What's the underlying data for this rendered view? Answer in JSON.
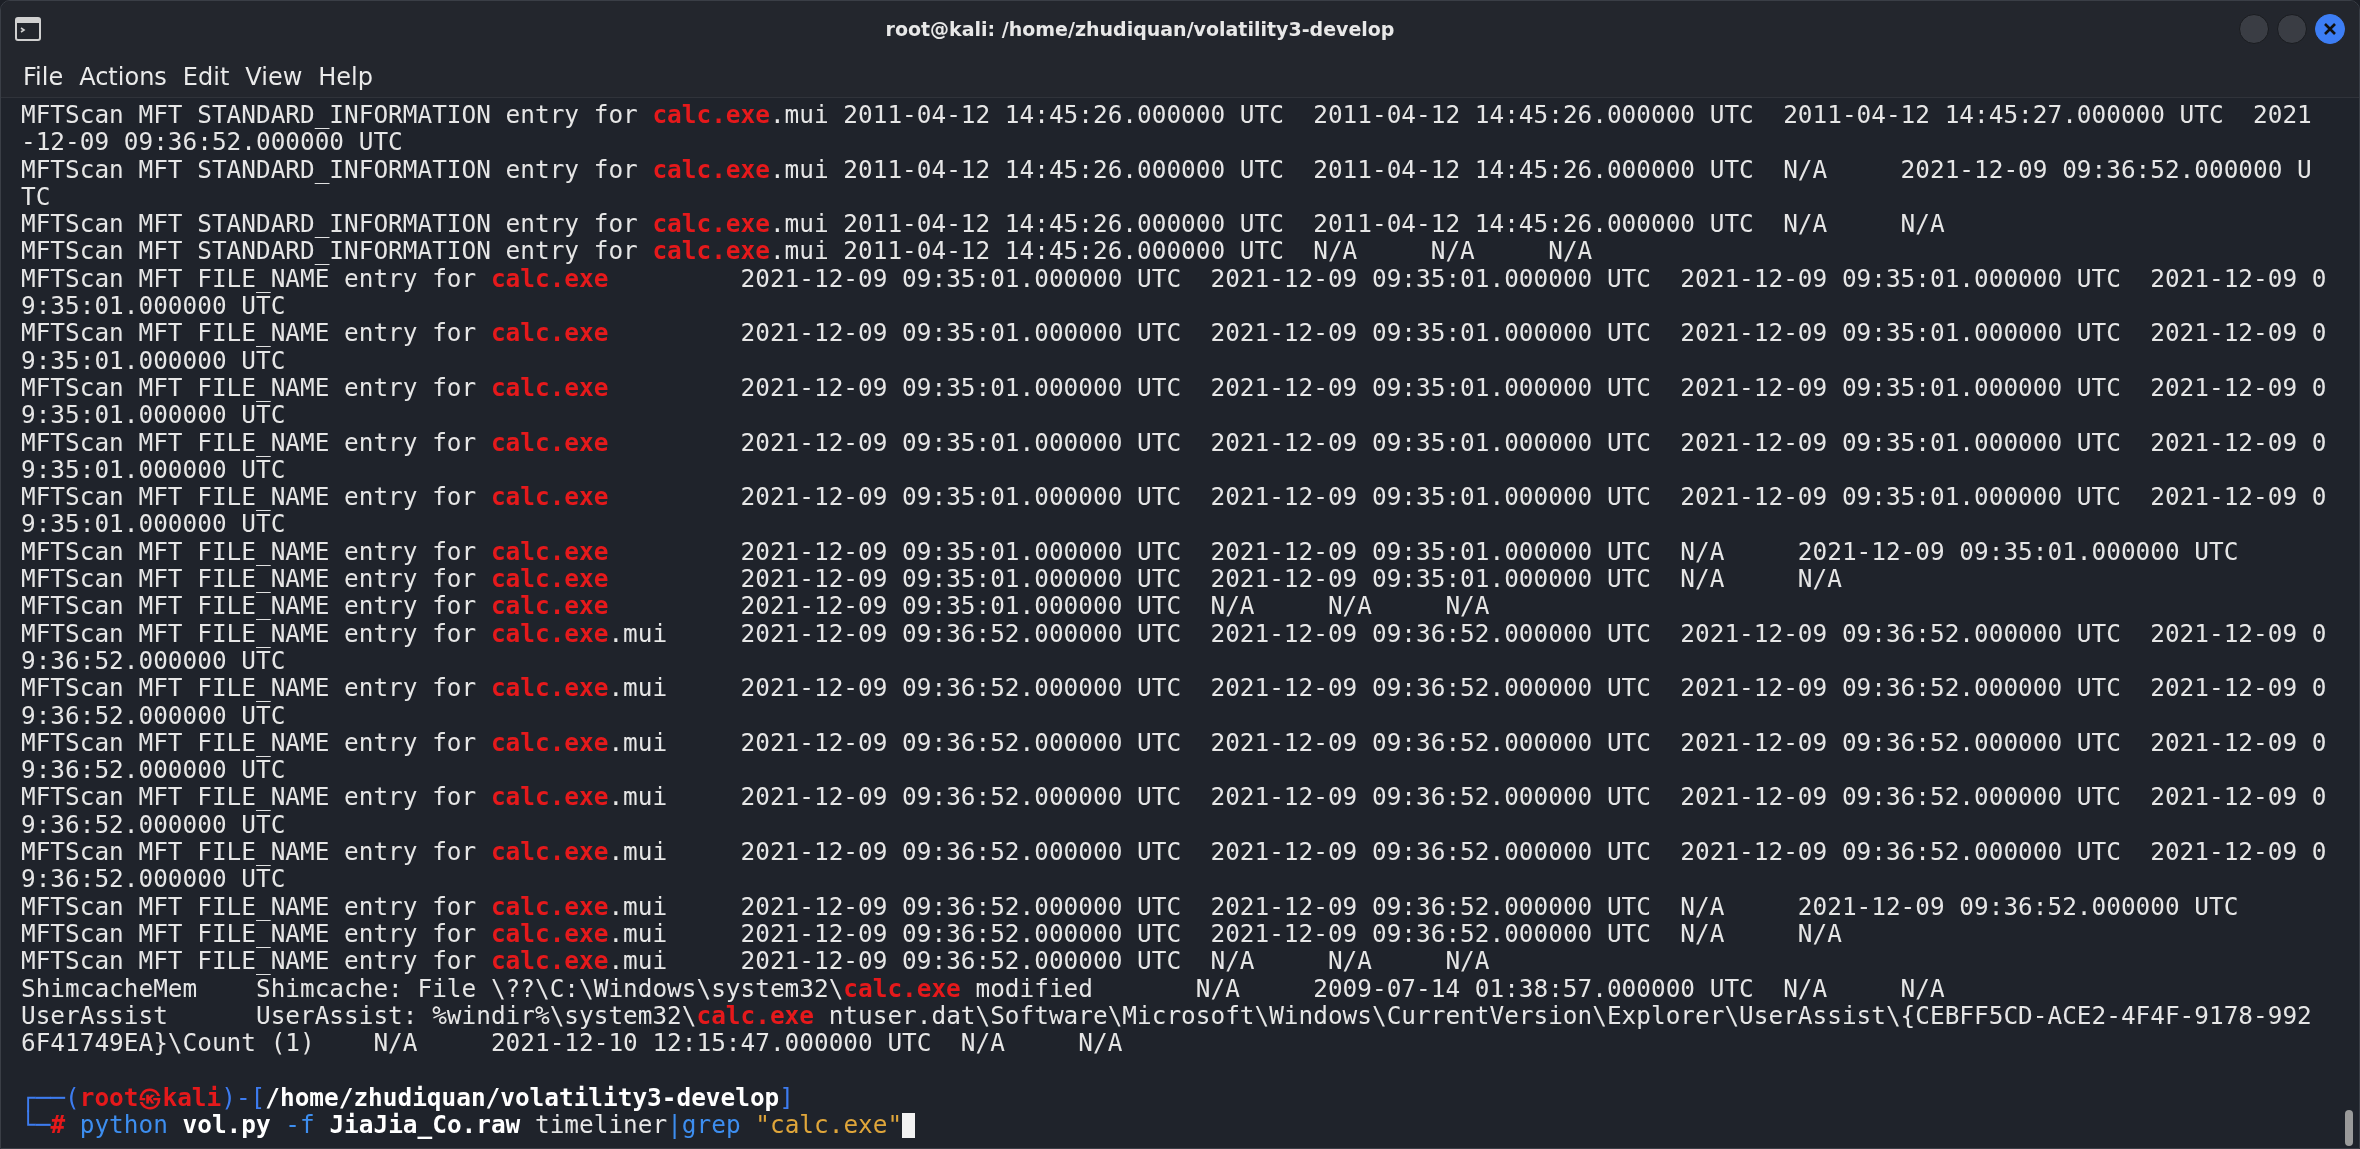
{
  "window": {
    "title": "root@kali: /home/zhudiquan/volatility3-develop"
  },
  "menu": [
    "File",
    "Actions",
    "Edit",
    "View",
    "Help"
  ],
  "output": [
    {
      "before": "MFTScan MFT STANDARD_INFORMATION entry for ",
      "match": "calc.exe",
      "after": ".mui 2011-04-12 14:45:26.000000 UTC  2011-04-12 14:45:26.000000 UTC  2011-04-12 14:45:27.000000 UTC  2021"
    },
    {
      "before": "-12-09 09:36:52.000000 UTC"
    },
    {
      "before": "MFTScan MFT STANDARD_INFORMATION entry for ",
      "match": "calc.exe",
      "after": ".mui 2011-04-12 14:45:26.000000 UTC  2011-04-12 14:45:26.000000 UTC  N/A     2021-12-09 09:36:52.000000 U"
    },
    {
      "before": "TC"
    },
    {
      "before": "MFTScan MFT STANDARD_INFORMATION entry for ",
      "match": "calc.exe",
      "after": ".mui 2011-04-12 14:45:26.000000 UTC  2011-04-12 14:45:26.000000 UTC  N/A     N/A"
    },
    {
      "before": "MFTScan MFT STANDARD_INFORMATION entry for ",
      "match": "calc.exe",
      "after": ".mui 2011-04-12 14:45:26.000000 UTC  N/A     N/A     N/A"
    },
    {
      "before": "MFTScan MFT FILE_NAME entry for ",
      "match": "calc.exe",
      "after": "         2021-12-09 09:35:01.000000 UTC  2021-12-09 09:35:01.000000 UTC  2021-12-09 09:35:01.000000 UTC  2021-12-09 0"
    },
    {
      "before": "9:35:01.000000 UTC"
    },
    {
      "before": "MFTScan MFT FILE_NAME entry for ",
      "match": "calc.exe",
      "after": "         2021-12-09 09:35:01.000000 UTC  2021-12-09 09:35:01.000000 UTC  2021-12-09 09:35:01.000000 UTC  2021-12-09 0"
    },
    {
      "before": "9:35:01.000000 UTC"
    },
    {
      "before": "MFTScan MFT FILE_NAME entry for ",
      "match": "calc.exe",
      "after": "         2021-12-09 09:35:01.000000 UTC  2021-12-09 09:35:01.000000 UTC  2021-12-09 09:35:01.000000 UTC  2021-12-09 0"
    },
    {
      "before": "9:35:01.000000 UTC"
    },
    {
      "before": "MFTScan MFT FILE_NAME entry for ",
      "match": "calc.exe",
      "after": "         2021-12-09 09:35:01.000000 UTC  2021-12-09 09:35:01.000000 UTC  2021-12-09 09:35:01.000000 UTC  2021-12-09 0"
    },
    {
      "before": "9:35:01.000000 UTC"
    },
    {
      "before": "MFTScan MFT FILE_NAME entry for ",
      "match": "calc.exe",
      "after": "         2021-12-09 09:35:01.000000 UTC  2021-12-09 09:35:01.000000 UTC  2021-12-09 09:35:01.000000 UTC  2021-12-09 0"
    },
    {
      "before": "9:35:01.000000 UTC"
    },
    {
      "before": "MFTScan MFT FILE_NAME entry for ",
      "match": "calc.exe",
      "after": "         2021-12-09 09:35:01.000000 UTC  2021-12-09 09:35:01.000000 UTC  N/A     2021-12-09 09:35:01.000000 UTC"
    },
    {
      "before": "MFTScan MFT FILE_NAME entry for ",
      "match": "calc.exe",
      "after": "         2021-12-09 09:35:01.000000 UTC  2021-12-09 09:35:01.000000 UTC  N/A     N/A"
    },
    {
      "before": "MFTScan MFT FILE_NAME entry for ",
      "match": "calc.exe",
      "after": "         2021-12-09 09:35:01.000000 UTC  N/A     N/A     N/A"
    },
    {
      "before": "MFTScan MFT FILE_NAME entry for ",
      "match": "calc.exe",
      "after": ".mui     2021-12-09 09:36:52.000000 UTC  2021-12-09 09:36:52.000000 UTC  2021-12-09 09:36:52.000000 UTC  2021-12-09 0"
    },
    {
      "before": "9:36:52.000000 UTC"
    },
    {
      "before": "MFTScan MFT FILE_NAME entry for ",
      "match": "calc.exe",
      "after": ".mui     2021-12-09 09:36:52.000000 UTC  2021-12-09 09:36:52.000000 UTC  2021-12-09 09:36:52.000000 UTC  2021-12-09 0"
    },
    {
      "before": "9:36:52.000000 UTC"
    },
    {
      "before": "MFTScan MFT FILE_NAME entry for ",
      "match": "calc.exe",
      "after": ".mui     2021-12-09 09:36:52.000000 UTC  2021-12-09 09:36:52.000000 UTC  2021-12-09 09:36:52.000000 UTC  2021-12-09 0"
    },
    {
      "before": "9:36:52.000000 UTC"
    },
    {
      "before": "MFTScan MFT FILE_NAME entry for ",
      "match": "calc.exe",
      "after": ".mui     2021-12-09 09:36:52.000000 UTC  2021-12-09 09:36:52.000000 UTC  2021-12-09 09:36:52.000000 UTC  2021-12-09 0"
    },
    {
      "before": "9:36:52.000000 UTC"
    },
    {
      "before": "MFTScan MFT FILE_NAME entry for ",
      "match": "calc.exe",
      "after": ".mui     2021-12-09 09:36:52.000000 UTC  2021-12-09 09:36:52.000000 UTC  2021-12-09 09:36:52.000000 UTC  2021-12-09 0"
    },
    {
      "before": "9:36:52.000000 UTC"
    },
    {
      "before": "MFTScan MFT FILE_NAME entry for ",
      "match": "calc.exe",
      "after": ".mui     2021-12-09 09:36:52.000000 UTC  2021-12-09 09:36:52.000000 UTC  N/A     2021-12-09 09:36:52.000000 UTC"
    },
    {
      "before": "MFTScan MFT FILE_NAME entry for ",
      "match": "calc.exe",
      "after": ".mui     2021-12-09 09:36:52.000000 UTC  2021-12-09 09:36:52.000000 UTC  N/A     N/A"
    },
    {
      "before": "MFTScan MFT FILE_NAME entry for ",
      "match": "calc.exe",
      "after": ".mui     2021-12-09 09:36:52.000000 UTC  N/A     N/A     N/A"
    },
    {
      "before": "ShimcacheMem    Shimcache: File \\??\\C:\\Windows\\system32\\",
      "match": "calc.exe",
      "after": " modified       N/A     2009-07-14 01:38:57.000000 UTC  N/A     N/A"
    },
    {
      "before": "UserAssist      UserAssist: %windir%\\system32\\",
      "match": "calc.exe",
      "after": " ntuser.dat\\Software\\Microsoft\\Windows\\CurrentVersion\\Explorer\\UserAssist\\{CEBFF5CD-ACE2-4F4F-9178-992"
    },
    {
      "before": "6F41749EA}\\Count (1)    N/A     2021-12-10 12:15:47.000000 UTC  N/A     N/A"
    }
  ],
  "prompt": {
    "lines": [
      [
        {
          "kind": "frame",
          "text": "┌──("
        },
        {
          "kind": "user",
          "text": "root㉿kali"
        },
        {
          "kind": "frame",
          "text": ")-["
        },
        {
          "kind": "path",
          "text": "/home/zhudiquan/volatility3-develop"
        },
        {
          "kind": "frame",
          "text": "]"
        }
      ],
      [
        {
          "kind": "frame",
          "text": "└─"
        },
        {
          "kind": "user",
          "text": "# "
        },
        {
          "kind": "cmd",
          "text": "python"
        },
        {
          "kind": "path",
          "text": " vol.py"
        },
        {
          "kind": "cmd",
          "text": " -f"
        },
        {
          "kind": "path",
          "text": " JiaJia_Co.raw"
        },
        {
          "kind": "plain",
          "text": " timeliner"
        },
        {
          "kind": "cmd",
          "text": "|grep"
        },
        {
          "kind": "str",
          "text": " \"calc.exe\""
        }
      ]
    ]
  }
}
